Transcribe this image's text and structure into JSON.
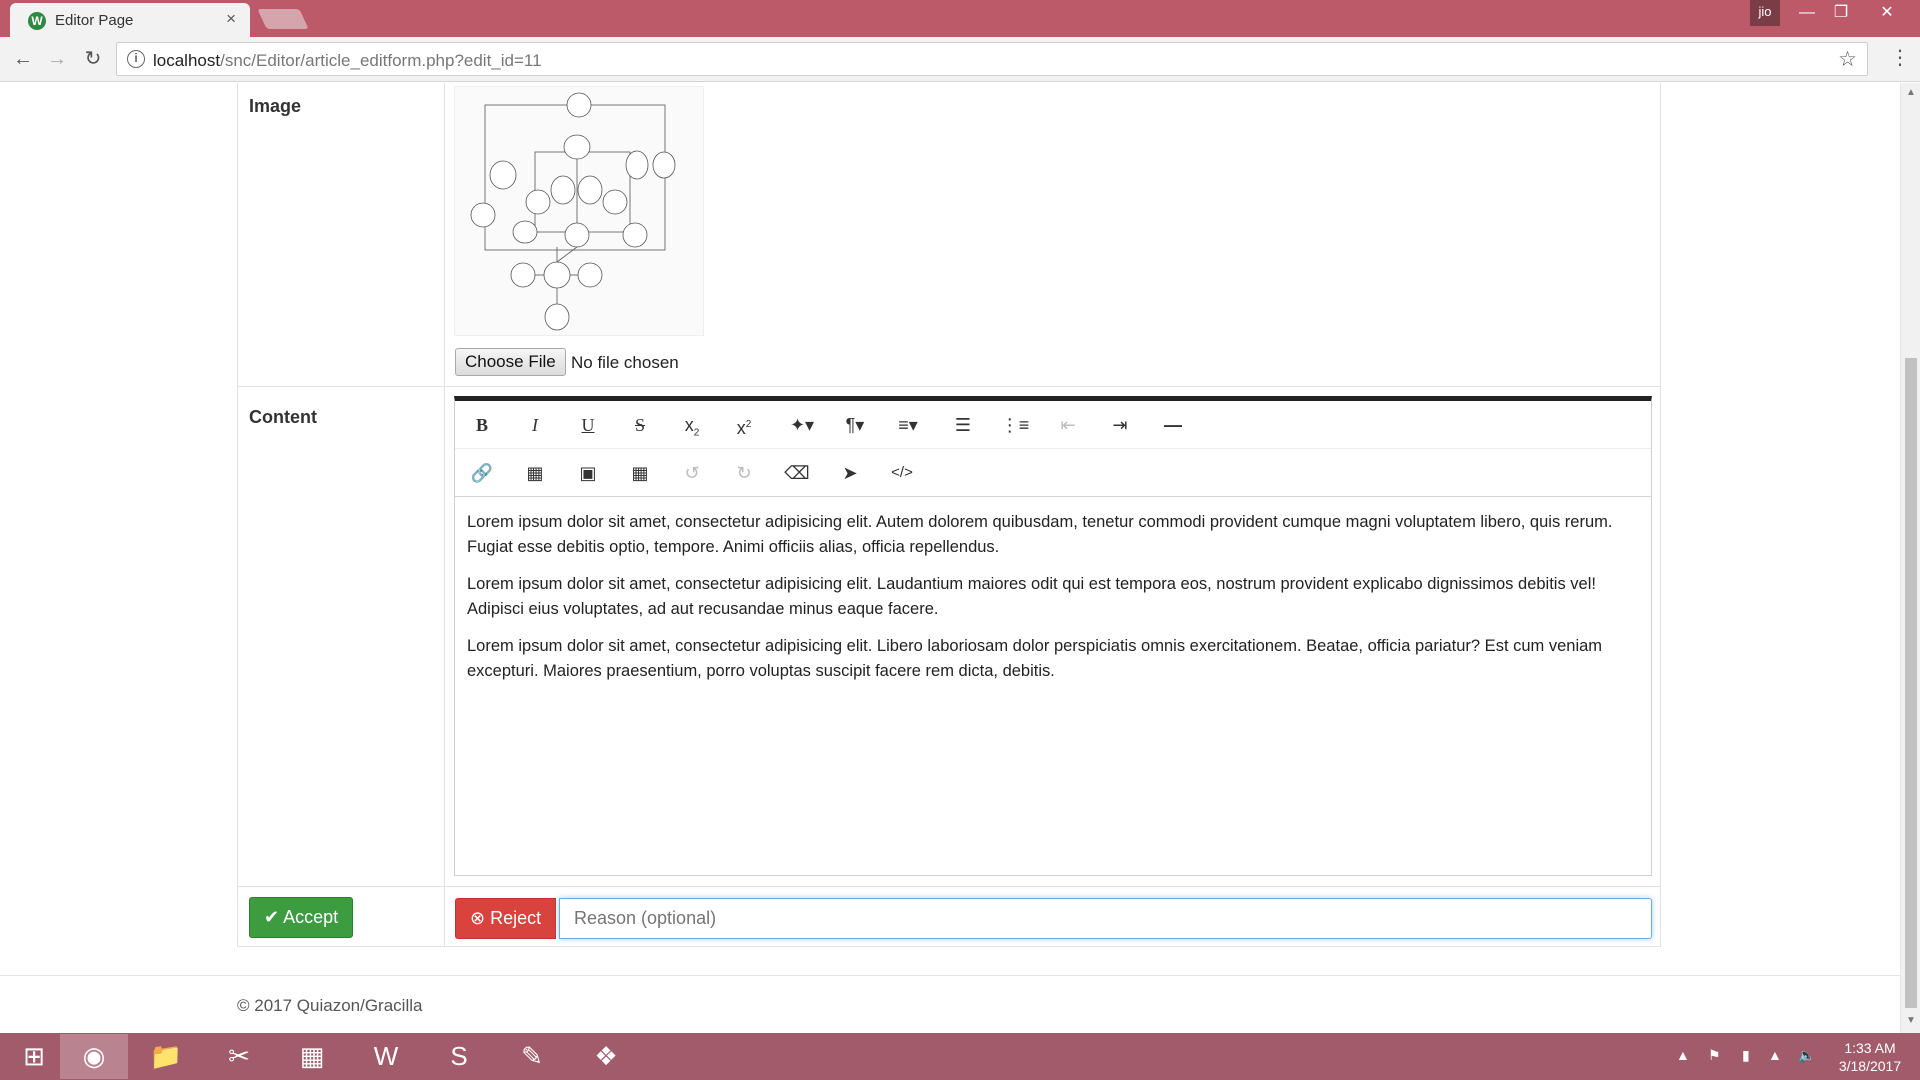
{
  "browser": {
    "tab_title": "Editor Page",
    "tab_close": "×",
    "profile": "jio",
    "url_host": "localhost",
    "url_path": "/snc/Editor/article_editform.php?edit_id=11"
  },
  "form": {
    "image_label": "Image",
    "choose_file": "Choose File",
    "no_file": "No file chosen",
    "content_label": "Content",
    "paragraphs": [
      "Lorem ipsum dolor sit amet, consectetur adipisicing elit. Autem dolorem quibusdam, tenetur commodi provident cumque magni voluptatem libero, quis rerum. Fugiat esse debitis optio, tempore. Animi officiis alias, officia repellendus.",
      "Lorem ipsum dolor sit amet, consectetur adipisicing elit. Laudantium maiores odit qui est tempora eos, nostrum provident explicabo dignissimos debitis vel! Adipisci eius voluptates, ad aut recusandae minus eaque facere.",
      "Lorem ipsum dolor sit amet, consectetur adipisicing elit. Libero laboriosam dolor perspiciatis omnis exercitationem. Beatae, officia pariatur? Est cum veniam excepturi. Maiores praesentium, porro voluptas suscipit facere rem dicta, debitis."
    ],
    "accept": "Accept",
    "reject": "Reject",
    "reason_placeholder": "Reason (optional)"
  },
  "footer": {
    "text": "© 2017 Quiazon/Gracilla"
  },
  "taskbar": {
    "time": "1:33 AM",
    "date": "3/18/2017"
  },
  "colors": {
    "titlebar": "#bd5a6a",
    "accept": "#3d9b40",
    "reject": "#d9433e",
    "taskbar": "#a25b6b"
  }
}
